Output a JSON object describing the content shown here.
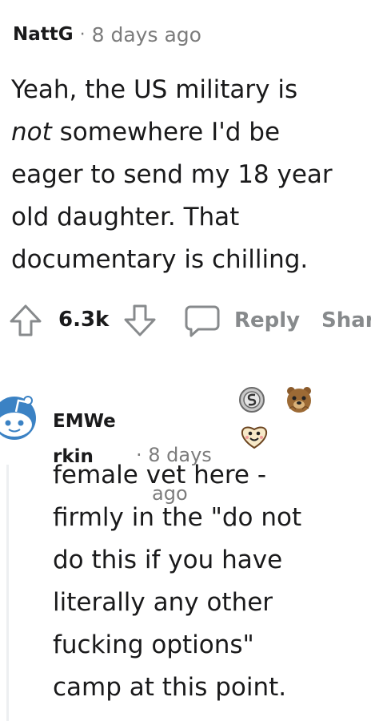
{
  "comment1": {
    "username": "NattG",
    "separator": "·",
    "timestamp": "8 days ago",
    "body_lines": [
      "Yeah, the US military is",
      "not",
      " somewhere I'd be",
      "eager to send my 18 year",
      "old daughter. That",
      "documentary is chilling."
    ],
    "actions": {
      "upvote_icon": "arrow-up-icon",
      "vote_count": "6.3k",
      "downvote_icon": "arrow-down-icon",
      "reply_icon": "speech-bubble-icon",
      "reply_label": "Reply",
      "share_label": "Shar"
    }
  },
  "comment2": {
    "avatar_icon": "reddit-snoo-avatar",
    "username_line1": "EMWe",
    "username_line2": "rkin",
    "timestamp_line1": "· 8 days",
    "timestamp_line2": "ago",
    "awards": [
      "silver-award-icon",
      "bear-award-icon",
      "wholesome-award-icon"
    ],
    "body_lines": [
      "female vet here -",
      "firmly in the \"do not",
      "do this if you have",
      "literally any other",
      "fucking options\"",
      "camp at this point."
    ]
  },
  "colors": {
    "text": "#1a1a1b",
    "meta": "#7c7c7c",
    "action": "#878a8c",
    "avatar_blue": "#3b82c4"
  }
}
